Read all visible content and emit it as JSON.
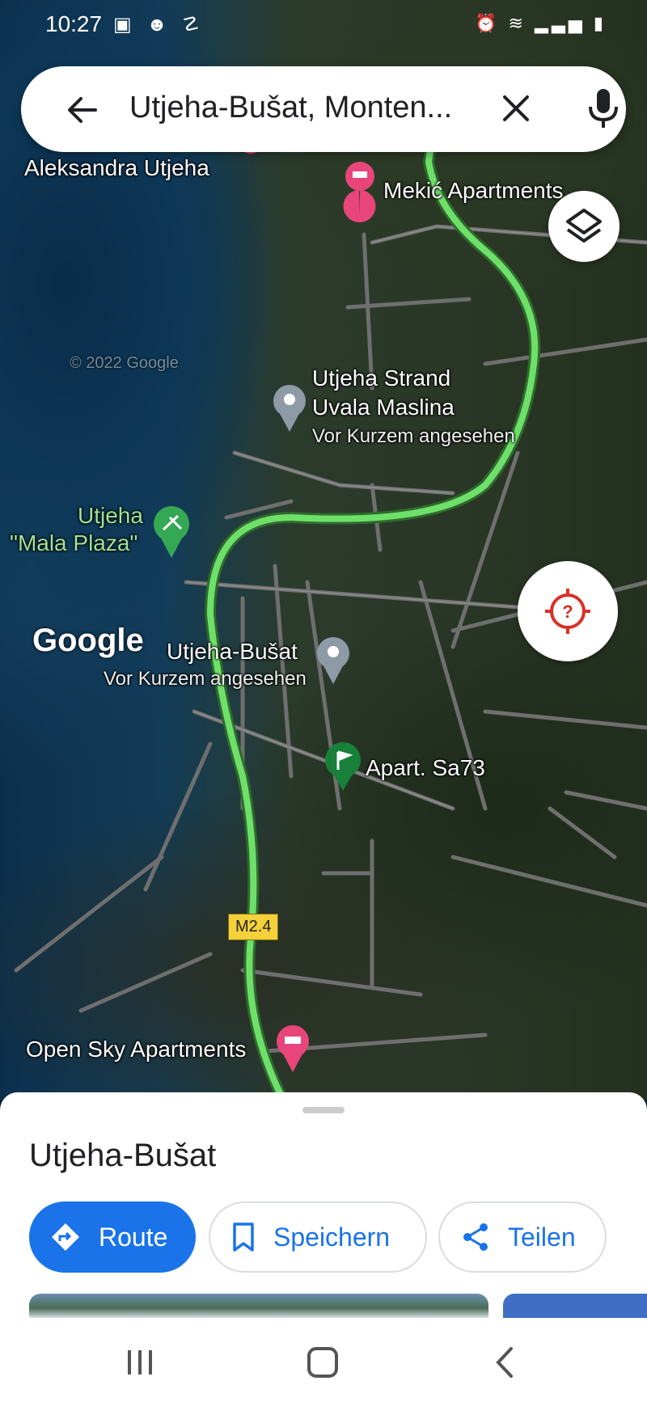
{
  "status_bar": {
    "time": "10:27"
  },
  "search": {
    "query": "Utjeha-Bušat, Monten..."
  },
  "map_labels": {
    "aleksandra": "Aleksandra Utjeha",
    "mekic": "Mekić Apartments",
    "strand_line1": "Utjeha Strand",
    "strand_line2": "Uvala Maslina",
    "strand_sub": "Vor Kurzem angesehen",
    "mala_line1": "Utjeha",
    "mala_line2": "\"Mala Plaza\"",
    "busat": "Utjeha-Bušat",
    "busat_sub": "Vor Kurzem angesehen",
    "apart": "Apart. Sa73",
    "open_sky": "Open Sky Apartments",
    "road": "M2.4",
    "google": "Google",
    "copyright": "© 2022 Google"
  },
  "place": {
    "title": "Utjeha-Bušat",
    "actions": {
      "route": "Route",
      "save": "Speichern",
      "share": "Teilen"
    }
  },
  "colors": {
    "accent": "#1a73e8",
    "route_line": "#6ee06a",
    "hotel_pin": "#e8457b",
    "beach_pin": "#34a853"
  }
}
